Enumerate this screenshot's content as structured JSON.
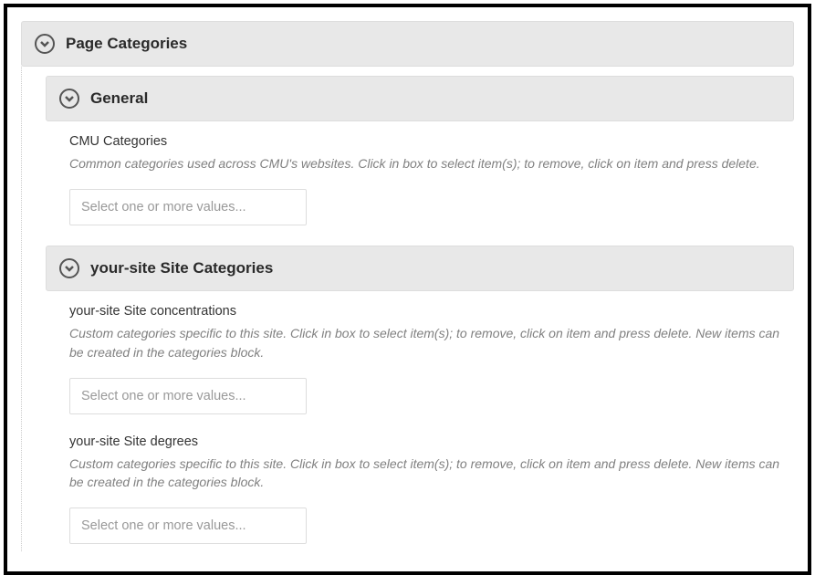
{
  "pageCategories": {
    "title": "Page Categories",
    "general": {
      "title": "General",
      "field": {
        "label": "CMU Categories",
        "help": "Common categories used across CMU's websites. Click in box to select item(s); to remove, click on item and press delete.",
        "placeholder": "Select one or more values..."
      }
    },
    "siteCategories": {
      "title": "your-site Site Categories",
      "concentrations": {
        "label": "your-site Site concentrations",
        "help": "Custom categories specific to this site. Click in box to select item(s); to remove, click on item and press delete. New items can be created in the categories block.",
        "placeholder": "Select one or more values..."
      },
      "degrees": {
        "label": "your-site Site degrees",
        "help": "Custom categories specific to this site. Click in box to select item(s); to remove, click on item and press delete. New items can be created in the categories block.",
        "placeholder": "Select one or more values..."
      }
    }
  }
}
